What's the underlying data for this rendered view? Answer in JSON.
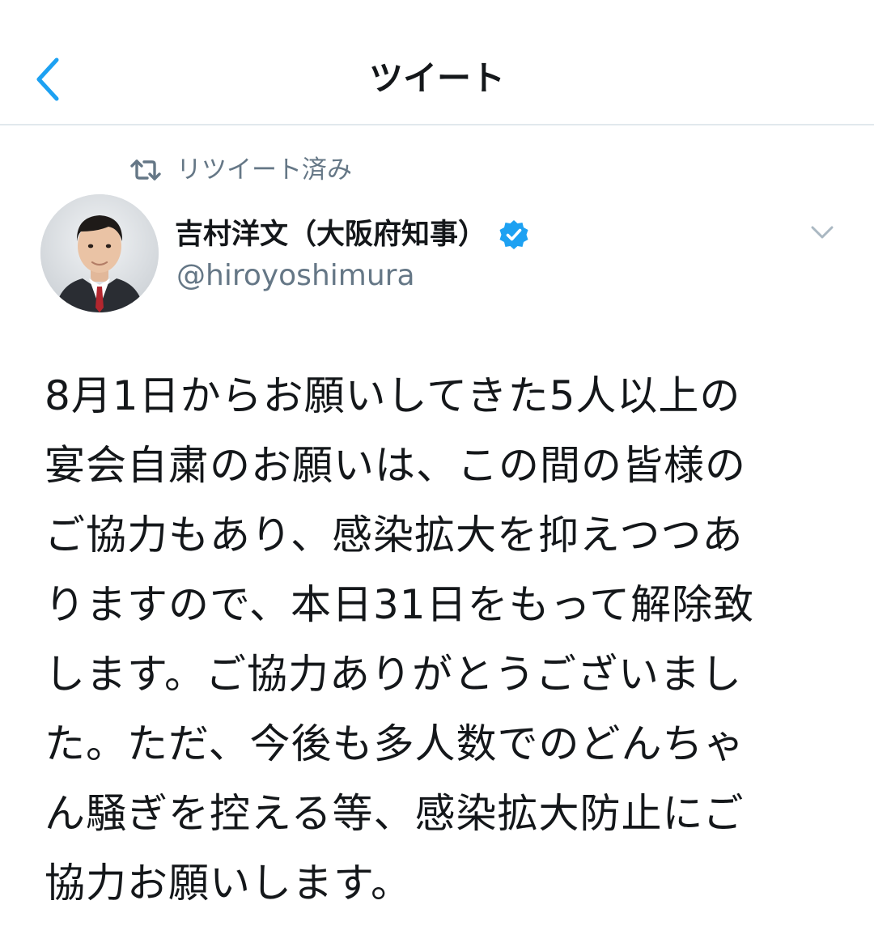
{
  "navbar": {
    "title": "ツイート",
    "back_icon": "chevron-left-icon",
    "accent_color": "#1da1f2"
  },
  "retweet": {
    "icon": "retweet-icon",
    "label": "リツイート済み"
  },
  "author": {
    "name": "吉村洋文（大阪府知事）",
    "handle": "@hiroyoshimura",
    "verified": true,
    "verified_color": "#1da1f2"
  },
  "tweet": {
    "text": "8月1日からお願いしてきた5人以上の\n宴会自粛のお願いは、この間の皆様の\nご協力もあり、感染拡大を抑えつつあ\nりますので、本日31日をもって解除致\nします。ご協力ありがとうございまし\nた。ただ、今後も多人数でのどんちゃ\nん騒ぎを控える等、感染拡大防止にご\n協力お願いします。"
  },
  "menu": {
    "icon": "chevron-down-icon"
  }
}
